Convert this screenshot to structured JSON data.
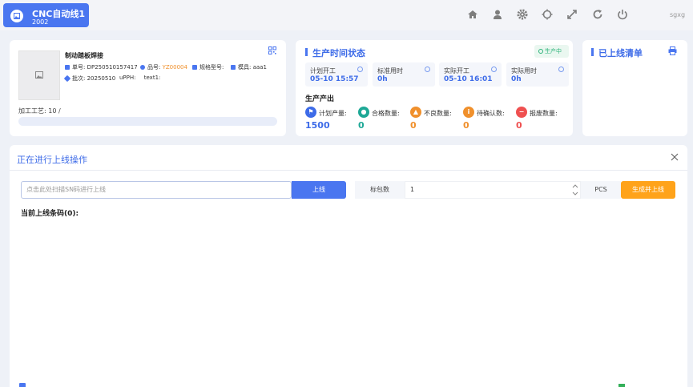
{
  "app": {
    "title": "CNC自动线1",
    "subtitle": "2002",
    "user": "sgxg"
  },
  "toolbar": {
    "icons": [
      "home-icon",
      "user-icon",
      "settings-icon",
      "sun-icon",
      "fullscreen-icon",
      "refresh-icon",
      "power-icon"
    ]
  },
  "product": {
    "name": "制动踏板焊接",
    "order_label": "单号:",
    "order_value": "DP250510157417",
    "part_label": "品号:",
    "part_value": "YZ00004",
    "spec_label": "规格型号:",
    "spec_value": "",
    "mold_label": "模具:",
    "mold_value": "aaa1",
    "batch_label": "批次:",
    "batch_value": "20250510",
    "uph_label": "uPPH:",
    "uph_value": "text1:",
    "process_label": "加工工艺:",
    "process_value": "10 /",
    "progress": 0
  },
  "production_time": {
    "title": "生产时间状态",
    "status": "生产中",
    "boxes": [
      {
        "label": "计划开工",
        "value": "05-10 15:57"
      },
      {
        "label": "标准用时",
        "value": "0h"
      },
      {
        "label": "实际开工",
        "value": "05-10 16:01"
      },
      {
        "label": "实际用时",
        "value": "0h"
      }
    ],
    "output_title": "生产产出",
    "stats": [
      {
        "label": "计划产量:",
        "value": "1500",
        "color": "#3d6be8"
      },
      {
        "label": "合格数量:",
        "value": "0",
        "color": "#1ea896"
      },
      {
        "label": "不良数量:",
        "value": "0",
        "color": "#f0902c"
      },
      {
        "label": "待确认数:",
        "value": "0",
        "color": "#f0902c"
      },
      {
        "label": "报废数量:",
        "value": "0",
        "color": "#ef5050"
      }
    ]
  },
  "online_list": {
    "title": "已上线清单"
  },
  "operation": {
    "title": "正在进行上线操作",
    "sn_placeholder": "点击此处扫描SN码进行上线",
    "online_button": "上线",
    "pack_label": "标包数",
    "pack_value": "1",
    "unit": "PCS",
    "generate_button": "生成并上线",
    "current_label": "当前上线条码(0):"
  }
}
